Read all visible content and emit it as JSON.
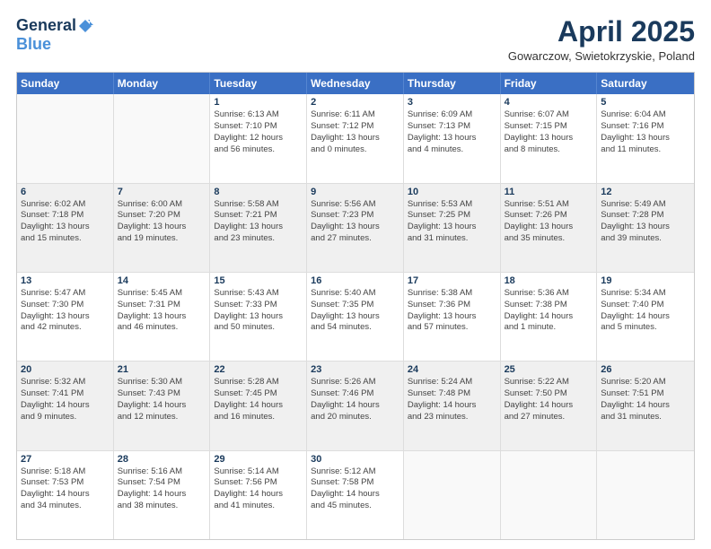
{
  "header": {
    "logo_general": "General",
    "logo_blue": "Blue",
    "month": "April 2025",
    "location": "Gowarczow, Swietokrzyskie, Poland"
  },
  "days_of_week": [
    "Sunday",
    "Monday",
    "Tuesday",
    "Wednesday",
    "Thursday",
    "Friday",
    "Saturday"
  ],
  "weeks": [
    {
      "shaded": false,
      "cells": [
        {
          "day": "",
          "lines": []
        },
        {
          "day": "",
          "lines": []
        },
        {
          "day": "1",
          "lines": [
            "Sunrise: 6:13 AM",
            "Sunset: 7:10 PM",
            "Daylight: 12 hours",
            "and 56 minutes."
          ]
        },
        {
          "day": "2",
          "lines": [
            "Sunrise: 6:11 AM",
            "Sunset: 7:12 PM",
            "Daylight: 13 hours",
            "and 0 minutes."
          ]
        },
        {
          "day": "3",
          "lines": [
            "Sunrise: 6:09 AM",
            "Sunset: 7:13 PM",
            "Daylight: 13 hours",
            "and 4 minutes."
          ]
        },
        {
          "day": "4",
          "lines": [
            "Sunrise: 6:07 AM",
            "Sunset: 7:15 PM",
            "Daylight: 13 hours",
            "and 8 minutes."
          ]
        },
        {
          "day": "5",
          "lines": [
            "Sunrise: 6:04 AM",
            "Sunset: 7:16 PM",
            "Daylight: 13 hours",
            "and 11 minutes."
          ]
        }
      ]
    },
    {
      "shaded": true,
      "cells": [
        {
          "day": "6",
          "lines": [
            "Sunrise: 6:02 AM",
            "Sunset: 7:18 PM",
            "Daylight: 13 hours",
            "and 15 minutes."
          ]
        },
        {
          "day": "7",
          "lines": [
            "Sunrise: 6:00 AM",
            "Sunset: 7:20 PM",
            "Daylight: 13 hours",
            "and 19 minutes."
          ]
        },
        {
          "day": "8",
          "lines": [
            "Sunrise: 5:58 AM",
            "Sunset: 7:21 PM",
            "Daylight: 13 hours",
            "and 23 minutes."
          ]
        },
        {
          "day": "9",
          "lines": [
            "Sunrise: 5:56 AM",
            "Sunset: 7:23 PM",
            "Daylight: 13 hours",
            "and 27 minutes."
          ]
        },
        {
          "day": "10",
          "lines": [
            "Sunrise: 5:53 AM",
            "Sunset: 7:25 PM",
            "Daylight: 13 hours",
            "and 31 minutes."
          ]
        },
        {
          "day": "11",
          "lines": [
            "Sunrise: 5:51 AM",
            "Sunset: 7:26 PM",
            "Daylight: 13 hours",
            "and 35 minutes."
          ]
        },
        {
          "day": "12",
          "lines": [
            "Sunrise: 5:49 AM",
            "Sunset: 7:28 PM",
            "Daylight: 13 hours",
            "and 39 minutes."
          ]
        }
      ]
    },
    {
      "shaded": false,
      "cells": [
        {
          "day": "13",
          "lines": [
            "Sunrise: 5:47 AM",
            "Sunset: 7:30 PM",
            "Daylight: 13 hours",
            "and 42 minutes."
          ]
        },
        {
          "day": "14",
          "lines": [
            "Sunrise: 5:45 AM",
            "Sunset: 7:31 PM",
            "Daylight: 13 hours",
            "and 46 minutes."
          ]
        },
        {
          "day": "15",
          "lines": [
            "Sunrise: 5:43 AM",
            "Sunset: 7:33 PM",
            "Daylight: 13 hours",
            "and 50 minutes."
          ]
        },
        {
          "day": "16",
          "lines": [
            "Sunrise: 5:40 AM",
            "Sunset: 7:35 PM",
            "Daylight: 13 hours",
            "and 54 minutes."
          ]
        },
        {
          "day": "17",
          "lines": [
            "Sunrise: 5:38 AM",
            "Sunset: 7:36 PM",
            "Daylight: 13 hours",
            "and 57 minutes."
          ]
        },
        {
          "day": "18",
          "lines": [
            "Sunrise: 5:36 AM",
            "Sunset: 7:38 PM",
            "Daylight: 14 hours",
            "and 1 minute."
          ]
        },
        {
          "day": "19",
          "lines": [
            "Sunrise: 5:34 AM",
            "Sunset: 7:40 PM",
            "Daylight: 14 hours",
            "and 5 minutes."
          ]
        }
      ]
    },
    {
      "shaded": true,
      "cells": [
        {
          "day": "20",
          "lines": [
            "Sunrise: 5:32 AM",
            "Sunset: 7:41 PM",
            "Daylight: 14 hours",
            "and 9 minutes."
          ]
        },
        {
          "day": "21",
          "lines": [
            "Sunrise: 5:30 AM",
            "Sunset: 7:43 PM",
            "Daylight: 14 hours",
            "and 12 minutes."
          ]
        },
        {
          "day": "22",
          "lines": [
            "Sunrise: 5:28 AM",
            "Sunset: 7:45 PM",
            "Daylight: 14 hours",
            "and 16 minutes."
          ]
        },
        {
          "day": "23",
          "lines": [
            "Sunrise: 5:26 AM",
            "Sunset: 7:46 PM",
            "Daylight: 14 hours",
            "and 20 minutes."
          ]
        },
        {
          "day": "24",
          "lines": [
            "Sunrise: 5:24 AM",
            "Sunset: 7:48 PM",
            "Daylight: 14 hours",
            "and 23 minutes."
          ]
        },
        {
          "day": "25",
          "lines": [
            "Sunrise: 5:22 AM",
            "Sunset: 7:50 PM",
            "Daylight: 14 hours",
            "and 27 minutes."
          ]
        },
        {
          "day": "26",
          "lines": [
            "Sunrise: 5:20 AM",
            "Sunset: 7:51 PM",
            "Daylight: 14 hours",
            "and 31 minutes."
          ]
        }
      ]
    },
    {
      "shaded": false,
      "cells": [
        {
          "day": "27",
          "lines": [
            "Sunrise: 5:18 AM",
            "Sunset: 7:53 PM",
            "Daylight: 14 hours",
            "and 34 minutes."
          ]
        },
        {
          "day": "28",
          "lines": [
            "Sunrise: 5:16 AM",
            "Sunset: 7:54 PM",
            "Daylight: 14 hours",
            "and 38 minutes."
          ]
        },
        {
          "day": "29",
          "lines": [
            "Sunrise: 5:14 AM",
            "Sunset: 7:56 PM",
            "Daylight: 14 hours",
            "and 41 minutes."
          ]
        },
        {
          "day": "30",
          "lines": [
            "Sunrise: 5:12 AM",
            "Sunset: 7:58 PM",
            "Daylight: 14 hours",
            "and 45 minutes."
          ]
        },
        {
          "day": "",
          "lines": []
        },
        {
          "day": "",
          "lines": []
        },
        {
          "day": "",
          "lines": []
        }
      ]
    }
  ]
}
